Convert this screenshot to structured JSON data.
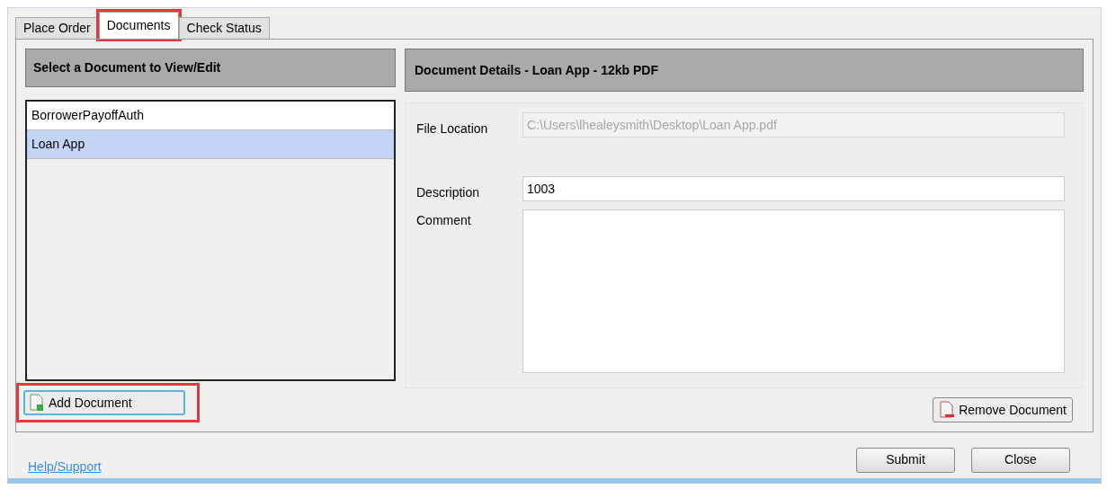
{
  "tabs": [
    {
      "label": "Place Order",
      "selected": false,
      "highlighted": false
    },
    {
      "label": "Documents",
      "selected": true,
      "highlighted": true
    },
    {
      "label": "Check Status",
      "selected": false,
      "highlighted": false
    }
  ],
  "documents_panel": {
    "title": "Select a Document to View/Edit",
    "items": [
      {
        "label": "BorrowerPayoffAuth",
        "selected": false
      },
      {
        "label": "Loan App",
        "selected": true
      }
    ],
    "add_button": {
      "label": "Add Document",
      "highlighted": true
    }
  },
  "details_panel": {
    "title": "Document Details - Loan App - 12kb PDF",
    "file_location": {
      "label": "File Location",
      "value": "C:\\Users\\lhealeysmith\\Desktop\\Loan App.pdf",
      "disabled": true
    },
    "description": {
      "label": "Description",
      "value": "1003"
    },
    "comment": {
      "label": "Comment"
    },
    "remove_button": {
      "label": "Remove Document"
    }
  },
  "footer": {
    "link": "Help/Support",
    "buttons": [
      "Submit",
      "Close"
    ]
  }
}
